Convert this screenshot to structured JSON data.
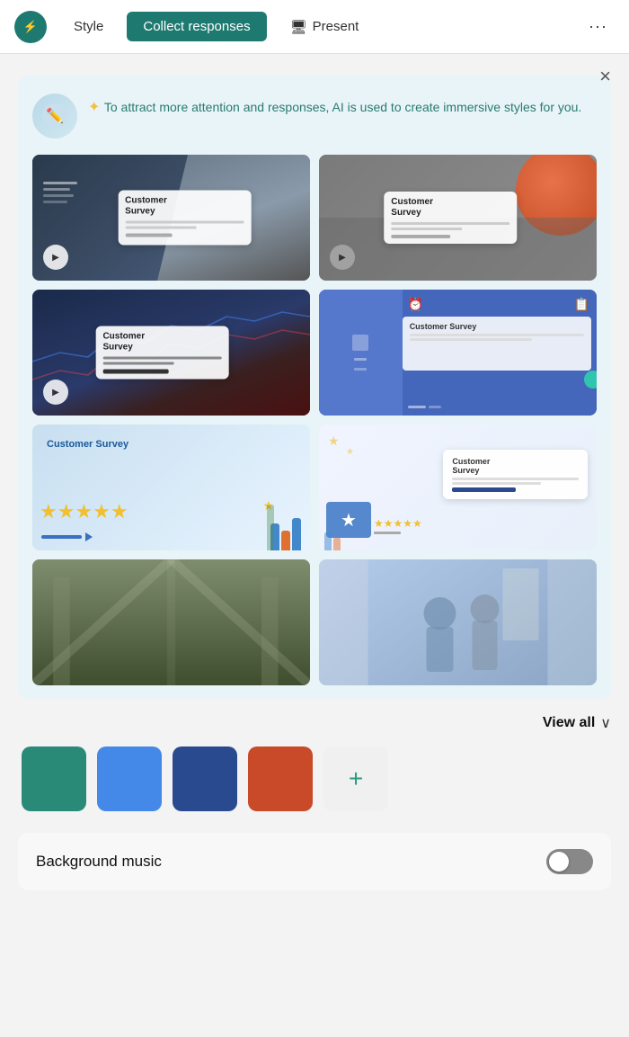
{
  "nav": {
    "style_label": "Style",
    "collect_label": "Collect responses",
    "present_label": "Present",
    "more_icon": "···"
  },
  "panel": {
    "close_icon": "×",
    "ai_text": "✦ To attract more attention and responses, AI is used to create immersive styles for you.",
    "thumbnails": [
      {
        "id": 1,
        "title": "Customer Survey",
        "type": "dark-photo"
      },
      {
        "id": 2,
        "title": "Customer Survey",
        "type": "gray-orange"
      },
      {
        "id": 3,
        "title": "Customer Survey",
        "type": "tech-dark"
      },
      {
        "id": 4,
        "title": "Customer Survey",
        "type": "blue-official"
      },
      {
        "id": 5,
        "title": "Customer Survey",
        "type": "blue-stars"
      },
      {
        "id": 6,
        "title": "Customer Survey",
        "type": "white-stars"
      },
      {
        "id": 7,
        "title": "",
        "type": "building"
      },
      {
        "id": 8,
        "title": "",
        "type": "people-photo"
      }
    ]
  },
  "view_all": {
    "label": "View all",
    "chevron": "∨"
  },
  "colors": {
    "swatches": [
      {
        "id": 1,
        "color": "#2a8a78",
        "label": "teal"
      },
      {
        "id": 2,
        "color": "#4488e8",
        "label": "blue"
      },
      {
        "id": 3,
        "color": "#2a4a90",
        "label": "dark-blue"
      },
      {
        "id": 4,
        "color": "#c84a28",
        "label": "orange-red"
      }
    ],
    "add_label": "+"
  },
  "music": {
    "label": "Background music",
    "toggle_off": false
  }
}
